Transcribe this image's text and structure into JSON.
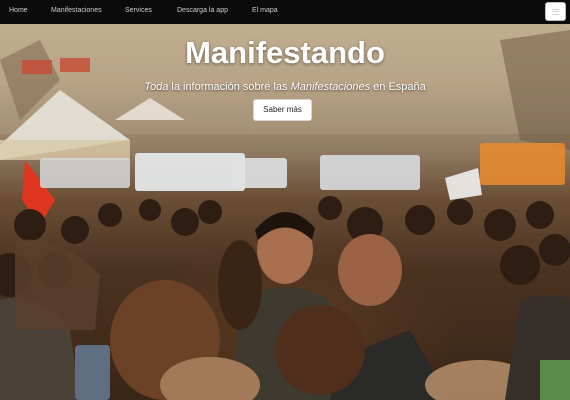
{
  "navbar": {
    "items": [
      {
        "label": "Home"
      },
      {
        "label": "Manifestaciones"
      },
      {
        "label": "Services"
      },
      {
        "label": "Descarga la app"
      },
      {
        "label": "El mapa"
      }
    ],
    "menu_icon": "hamburger-icon"
  },
  "hero": {
    "title": "Manifestando",
    "subtitle": {
      "part1": "Toda",
      "part2": " la información sobre las ",
      "part3": "Manifestaciones",
      "part4": " en España"
    },
    "cta_label": "Saber más"
  },
  "colors": {
    "navbar_bg": "#0b0b0b",
    "nav_text": "#d0d0d0",
    "hero_text": "#ffffff",
    "button_bg": "#ffffff",
    "button_text": "#222222"
  }
}
